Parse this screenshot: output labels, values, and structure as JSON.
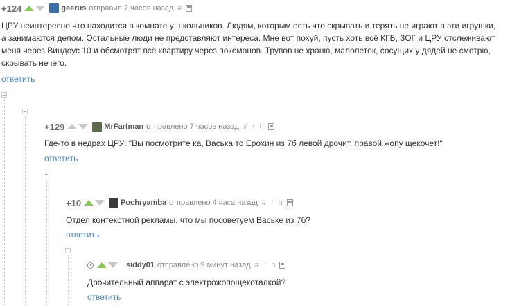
{
  "colors": {
    "upvote": "#8ac858",
    "downvote": "#c8c8c8",
    "link": "#4a87c2"
  },
  "comments": [
    {
      "rating": "+124",
      "user": "geerus",
      "meta": "отправил 7 часов назад",
      "hash": "#",
      "text": "ЦРУ неинтересно что находится в комнате у школьников. Людям, которым есть что скрывать и терять не играют в эти игрушки, а занимаются делом. Остальные люди не представляют интереса. Мне вот похуй, пусть хоть всё КГБ, ЗОГ и ЦРУ отслеживают меня через Виндоус 10 и обсмотрят всё квартиру через покемонов. Трупов не храню, малолеток, сосущих у дядей не смотрю, скрывать нечего.",
      "reply": "ответить",
      "avatar_color": "#3a6ea5"
    },
    {
      "rating": "+129",
      "user": "MrFartman",
      "meta": "отправлено 7 часов назад",
      "hash": "#",
      "up_arrow": "↑",
      "parent": "h",
      "text": "Где-то в недрах ЦРУ: \"Вы посмотрите ка, Васька то Ерохин из 7б левой дрочит, правой жопу щекочет!\"",
      "reply": "ответить",
      "avatar_color": "#5a6a4a"
    },
    {
      "rating": "+10",
      "user": "Pochryamba",
      "meta": "отправлено 4 часа назад",
      "hash": "#",
      "up_arrow": "↑",
      "parent": "h",
      "text": "Отдел контекстной рекламы, что мы посоветуем Ваське из 7б?",
      "reply": "ответить",
      "avatar_color": "#3a3a3a"
    },
    {
      "rating": "",
      "user": "siddy01",
      "meta": "отправлено 9 минут назад",
      "hash": "#",
      "up_arrow": "↑",
      "parent": "h",
      "text": "Дрочительный аппарат с электрожопощекоталкой?",
      "reply": "ответить"
    }
  ]
}
